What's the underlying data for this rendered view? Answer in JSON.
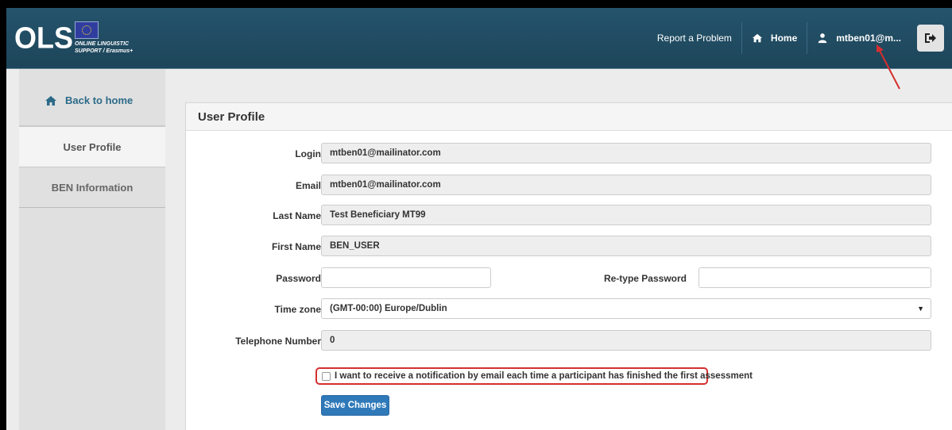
{
  "header": {
    "logo_text": "OLS",
    "logo_subtitle_1": "ONLINE LINGUISTIC",
    "logo_subtitle_2": "SUPPORT / Erasmus+",
    "report_problem": "Report a Problem",
    "home": "Home",
    "user": "mtben01@m..."
  },
  "sidebar": {
    "items": [
      {
        "label": "Back to home"
      },
      {
        "label": "User Profile"
      },
      {
        "label": "BEN Information"
      }
    ]
  },
  "panel": {
    "title": "User Profile",
    "login_label": "Login",
    "login_value": "mtben01@mailinator.com",
    "email_label": "Email",
    "email_value": "mtben01@mailinator.com",
    "lastname_label": "Last Name",
    "lastname_value": "Test Beneficiary MT99",
    "firstname_label": "First Name",
    "firstname_value": "BEN_USER",
    "password_label": "Password",
    "password_value": "",
    "retype_label": "Re-type Password",
    "retype_value": "",
    "timezone_label": "Time zone",
    "timezone_value": "(GMT-00:00) Europe/Dublin",
    "phone_label": "Telephone Number",
    "phone_value": "0",
    "notify_label": "I want to receive a notification by email each time a participant has finished the first assessment",
    "save_label": "Save Changes"
  },
  "colors": {
    "header_bg": "#1d4559",
    "accent": "#2f79b9",
    "highlight": "#d62f2f"
  }
}
